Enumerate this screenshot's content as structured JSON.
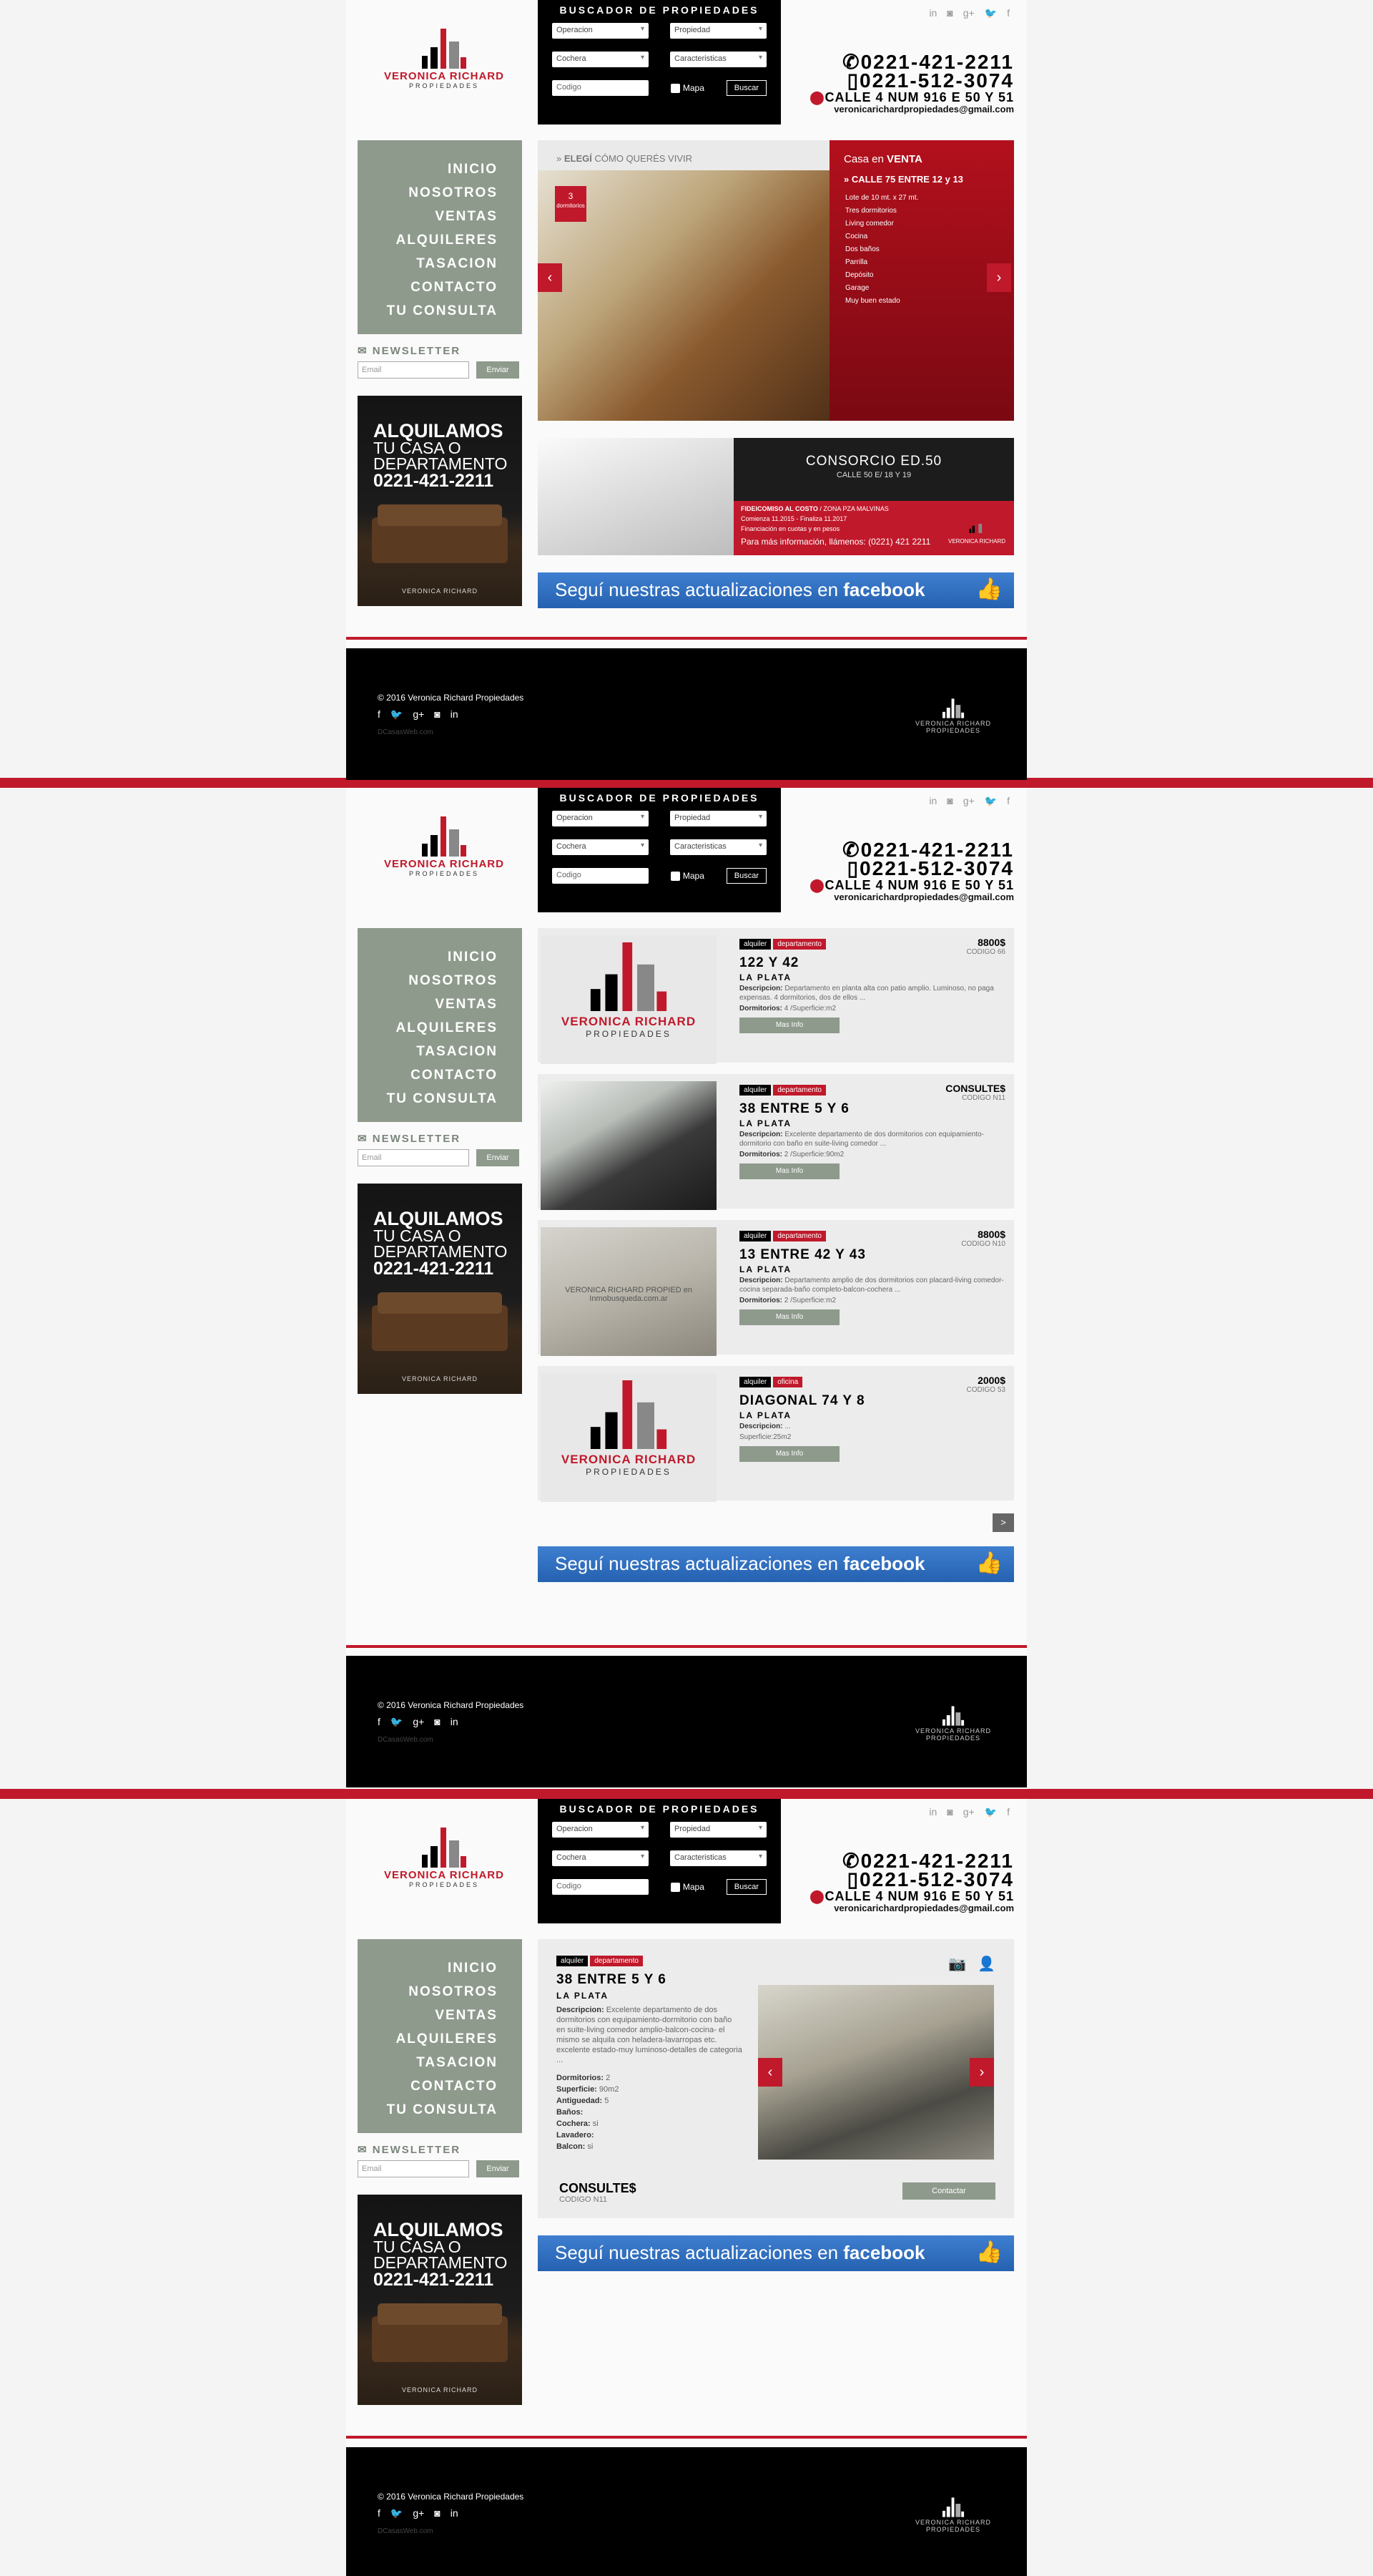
{
  "header": {
    "logo_name": "VERONICA RICHARD",
    "logo_sub": "PROPIEDADES",
    "search_title": "BUSCADOR DE PROPIEDADES",
    "select_operacion": "Operacion",
    "select_propiedad": "Propiedad",
    "select_cochera": "Cochera",
    "select_caracteristicas": "Caracteristicas",
    "codigo_placeholder": "Codigo",
    "mapa_label": "Mapa",
    "buscar_label": "Buscar",
    "phone1": "0221-421-2211",
    "phone2": "0221-512-3074",
    "address": "CALLE 4 NUM 916 E 50 Y 51",
    "email": "veronicarichardpropiedades@gmail.com",
    "social_icons": [
      "linkedin-icon",
      "instagram-icon",
      "googleplus-icon",
      "twitter-icon",
      "facebook-icon"
    ]
  },
  "menu": [
    "INICIO",
    "NOSOTROS",
    "VENTAS",
    "ALQUILERES",
    "TASACION",
    "CONTACTO",
    "TU CONSULTA"
  ],
  "newsletter": {
    "title": "NEWSLETTER",
    "email_placeholder": "Email",
    "send_label": "Enviar"
  },
  "promo": {
    "line1": "ALQUILAMOS",
    "line2": "TU CASA O",
    "line3": "DEPARTAMENTO",
    "phone": "0221-421-2211",
    "logo": "VERONICA RICHARD"
  },
  "home": {
    "elegi_bold": "ELEGÍ",
    "elegi_rest": "CÓMO QUERÉS VIVIR",
    "badge_num": "3",
    "badge_label": "dormitorios",
    "casa_prefix": "Casa en",
    "casa_op": "VENTA",
    "casa_address": "CALLE 75 ENTRE 12 y 13",
    "features": [
      "Lote de 10 mt. x 27 mt.",
      "Tres dormitorios",
      "Living comedor",
      "Cocina",
      "Dos baños",
      "Parrilla",
      "Depósito",
      "Garage",
      "Muy buen estado"
    ],
    "consorcio_title": "CONSORCIO ED.50",
    "consorcio_sub": "CALLE 50 E/ 18 Y 19",
    "consorcio_line1": "FIDEICOMISO AL COSTO",
    "consorcio_zone": "ZONA PZA MALVINAS",
    "consorcio_line2": "Comienza 11.2015 - Finaliza 11.2017",
    "consorcio_line3": "Financiación en cuotas y en pesos",
    "consorcio_info": "Para más información, llámenos: (0221) 421 2211",
    "consorcio_logo": "VERONICA RICHARD"
  },
  "facebook": {
    "text": "Seguí nuestras actualizaciones en",
    "brand": "facebook"
  },
  "listings": [
    {
      "op": "alquiler",
      "type": "departamento",
      "price": "8800$",
      "code": "CODIGO 66",
      "title": "122 Y 42",
      "city": "LA PLATA",
      "desc": "Departamento en planta alta con patio amplio. Luminoso, no paga expensas. 4 dormitorios, dos de ellos ...",
      "specs": "4 /Superficie:m2",
      "more": "Mas Info",
      "photo": "logo"
    },
    {
      "op": "alquiler",
      "type": "departamento",
      "price": "CONSULTE$",
      "code": "CODIGO N11",
      "title": "38 ENTRE 5 Y 6",
      "city": "LA PLATA",
      "desc": "Excelente departamento de dos dormitorios con equipamiento-dormitorio con baño en suite-living comedor ...",
      "specs": "2 /Superficie:90m2",
      "more": "Mas Info",
      "photo": "kitchen"
    },
    {
      "op": "alquiler",
      "type": "departamento",
      "price": "8800$",
      "code": "CODIGO N10",
      "title": "13 ENTRE 42 Y 43",
      "city": "LA PLATA",
      "desc": "Departamento amplio de dos dormitorios con placard-living comedor-cocina separada-baño completo-balcon-cochera ...",
      "specs": "2 /Superficie:m2",
      "more": "Mas Info",
      "photo": "bath",
      "watermark": "VERONICA RICHARD PROPIED en Inmobusqueda.com.ar"
    },
    {
      "op": "alquiler",
      "type": "oficina",
      "price": "2000$",
      "code": "CODIGO 53",
      "title": "DIAGONAL 74 Y 8",
      "city": "LA PLATA",
      "desc": "...",
      "specs": "",
      "superficie": "Superficie:25m2",
      "more": "Mas Info",
      "photo": "logo"
    }
  ],
  "labels": {
    "descripcion": "Descripcion:",
    "dormitorios": "Dormitorios:",
    "next": ">"
  },
  "detail": {
    "op": "alquiler",
    "type": "departamento",
    "title": "38 ENTRE 5 Y 6",
    "city": "LA PLATA",
    "desc": "Excelente departamento de dos dormitorios con equipamiento-dormitorio con baño en suite-living comedor amplio-balcon-cocina- el mismo se alquila con heladera-lavarropas etc. excelente estado-muy luminoso-detalles de categoria ...",
    "specs": [
      {
        "k": "Dormitorios:",
        "v": "2"
      },
      {
        "k": "Superficie:",
        "v": "90m2"
      },
      {
        "k": "Antiguedad:",
        "v": "5"
      },
      {
        "k": "Baños:",
        "v": ""
      },
      {
        "k": "Cochera:",
        "v": "si"
      },
      {
        "k": "Lavadero:",
        "v": ""
      },
      {
        "k": "Balcon:",
        "v": "si"
      }
    ],
    "price": "CONSULTE$",
    "code": "CODIGO N11",
    "contact": "Contactar"
  },
  "footer": {
    "copyright": "© 2016 Veronica Richard Propiedades",
    "credit": "DCasasWeb.com",
    "logo": "VERONICA RICHARD",
    "logo_sub": "PROPIEDADES"
  },
  "colors": {
    "accent": "#c0192b",
    "menu": "#8e9a8c",
    "black": "#000000",
    "facebook": "#2f6fc0"
  }
}
